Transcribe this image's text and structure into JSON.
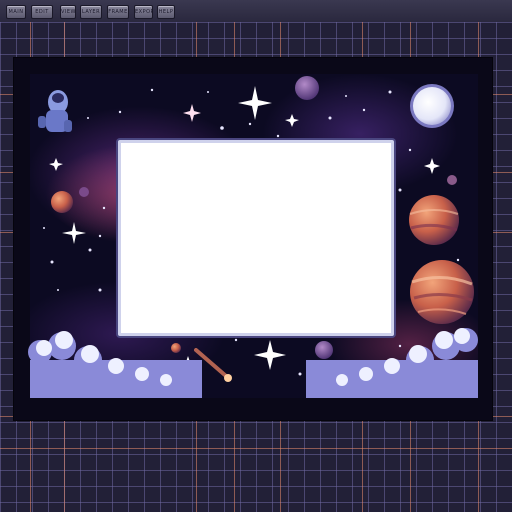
{
  "toolbar": {
    "buttons": [
      {
        "label": "MAIN"
      },
      {
        "label": "EDIT"
      },
      {
        "label": "VIEW"
      },
      {
        "label": "LAYER"
      },
      {
        "label": "FRAME"
      },
      {
        "label": "EXPORT"
      },
      {
        "label": "HELP"
      }
    ]
  },
  "canvas": {
    "frame_color": "#ffffff",
    "background_color": "#0c0a22",
    "grid_color": "#6e68a0",
    "guide_color": "#e88c6e",
    "decorations": [
      "planet-icon",
      "sparkle-star-icon",
      "astronaut-icon",
      "comet-icon",
      "moon-icon",
      "cloud-icon"
    ]
  }
}
